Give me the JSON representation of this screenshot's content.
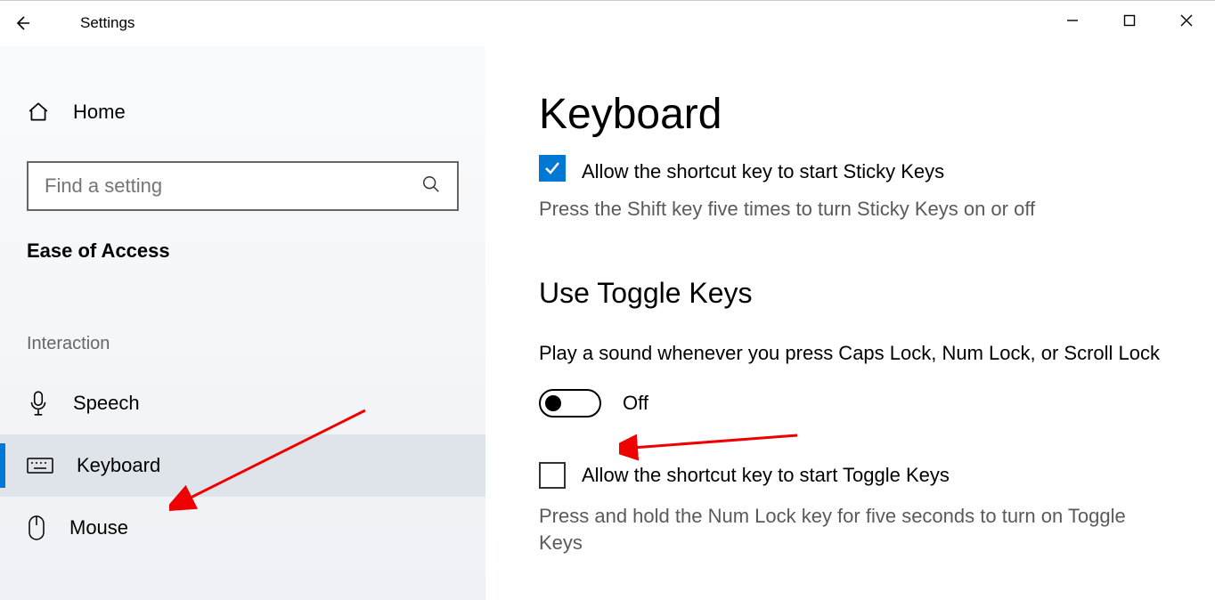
{
  "app": {
    "title": "Settings"
  },
  "sidebar": {
    "home_label": "Home",
    "search_placeholder": "Find a setting",
    "category": "Ease of Access",
    "group_label": "Interaction",
    "items": [
      {
        "label": "Speech"
      },
      {
        "label": "Keyboard"
      },
      {
        "label": "Mouse"
      }
    ]
  },
  "main": {
    "page_title": "Keyboard",
    "sticky_check_label": "Allow the shortcut key to start Sticky Keys",
    "sticky_desc": "Press the Shift key five times to turn Sticky Keys on or off",
    "section_toggle_title": "Use Toggle Keys",
    "toggle_body": "Play a sound whenever you press Caps Lock, Num Lock, or Scroll Lock",
    "toggle_state": "Off",
    "toggle_check_label": "Allow the shortcut key to start Toggle Keys",
    "toggle_desc": "Press and hold the Num Lock key for five seconds to turn on Toggle Keys"
  }
}
